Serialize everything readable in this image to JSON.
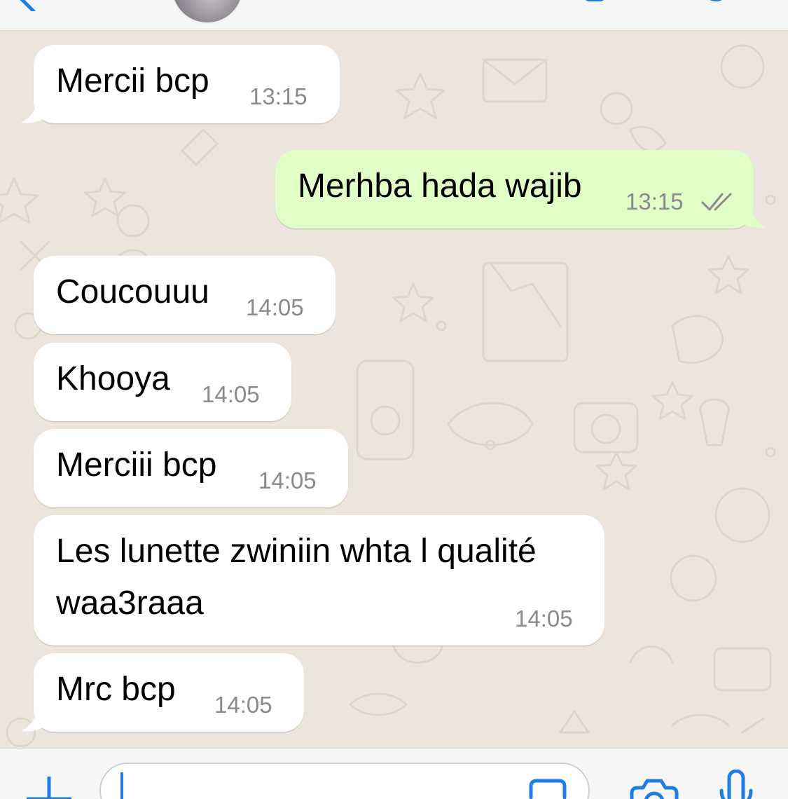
{
  "colors": {
    "chat_bg": "#ece5dd",
    "incoming_bubble": "#ffffff",
    "outgoing_bubble": "#e1fec6",
    "timestamp": "#8a8a8a",
    "accent": "#1f7ee0"
  },
  "header": {
    "icons": [
      "back-chevron-icon",
      "contact-avatar",
      "video-call-icon",
      "voice-call-icon"
    ]
  },
  "messages": [
    {
      "direction": "incoming",
      "text": "Mercii bcp",
      "time": "13:15"
    },
    {
      "direction": "outgoing",
      "text": "Merhba hada wajib",
      "time": "13:15",
      "status": "read-double-check"
    },
    {
      "direction": "incoming",
      "text": "Coucouuu",
      "time": "14:05"
    },
    {
      "direction": "incoming",
      "text": "Khooya",
      "time": "14:05"
    },
    {
      "direction": "incoming",
      "text": "Merciii bcp",
      "time": "14:05"
    },
    {
      "direction": "incoming",
      "text_line1": "Les lunette zwiniin whta l qualité",
      "text_line2": "waa3raaa",
      "time": "14:05"
    },
    {
      "direction": "incoming",
      "text": "Mrc bcp",
      "time": "14:05"
    }
  ],
  "composer": {
    "value": "",
    "icons": [
      "plus-icon",
      "sticker-icon",
      "camera-icon",
      "microphone-icon"
    ]
  }
}
